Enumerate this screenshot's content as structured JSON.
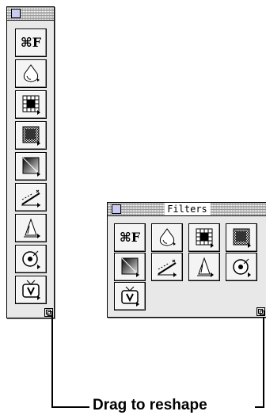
{
  "palettes": {
    "vertical": {
      "title": ""
    },
    "horizontal": {
      "title": "Filters"
    }
  },
  "tools": [
    {
      "label": "⌘F",
      "icon": "command-f-icon"
    },
    {
      "label": "",
      "icon": "blur-drop-icon"
    },
    {
      "label": "",
      "icon": "grid-distort-icon"
    },
    {
      "label": "",
      "icon": "noise-icon"
    },
    {
      "label": "",
      "icon": "gradient-pixelate-icon"
    },
    {
      "label": "",
      "icon": "sharpen-wand-icon"
    },
    {
      "label": "",
      "icon": "stylize-cone-icon"
    },
    {
      "label": "",
      "icon": "light-target-icon"
    },
    {
      "label": "",
      "icon": "video-tv-icon"
    }
  ],
  "callout": {
    "label": "Drag to reshape"
  },
  "colors": {
    "closebox": "#c9c9f2",
    "palette_bg": "#e8e8e8"
  }
}
